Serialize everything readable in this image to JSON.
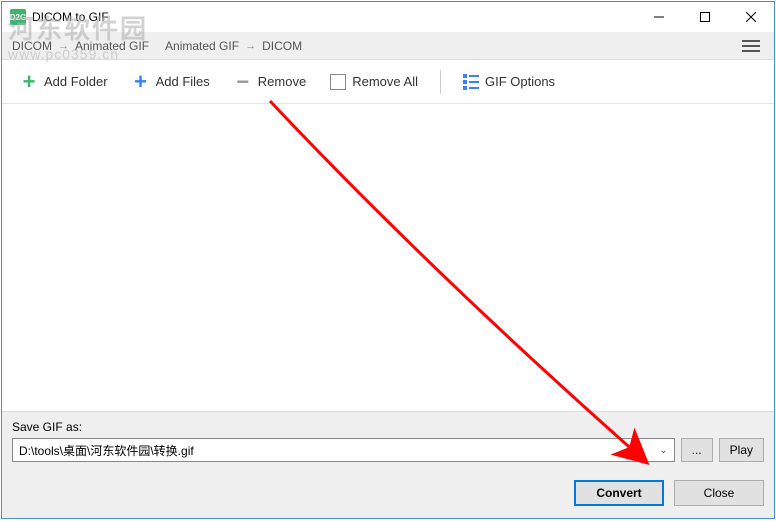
{
  "window": {
    "title": "DICOM to GIF"
  },
  "breadcrumb": {
    "c1": "DICOM",
    "c2": "Animated GIF",
    "c3": "Animated GIF",
    "c4": "DICOM"
  },
  "toolbar": {
    "add_folder": "Add Folder",
    "add_files": "Add Files",
    "remove": "Remove",
    "remove_all": "Remove All",
    "gif_options": "GIF Options"
  },
  "save": {
    "label": "Save GIF as:",
    "path": "D:\\tools\\桌面\\河东软件园\\转换.gif",
    "browse": "...",
    "play": "Play"
  },
  "actions": {
    "convert": "Convert",
    "close": "Close"
  },
  "watermark": {
    "line1": "河东软件园",
    "line2": "www.pc0359.cn"
  }
}
